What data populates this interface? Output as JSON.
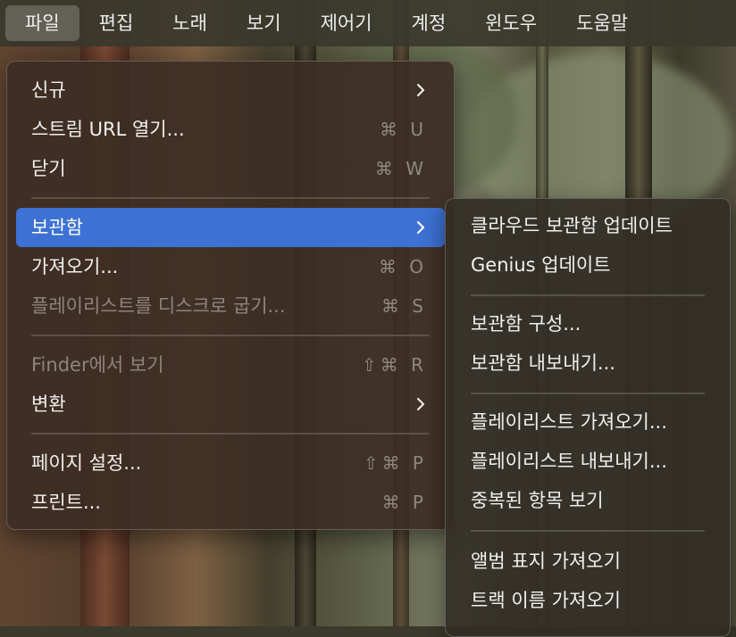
{
  "menubar": {
    "items": [
      "파일",
      "편집",
      "노래",
      "보기",
      "제어기",
      "계정",
      "윈도우",
      "도움말"
    ],
    "active_index": 0
  },
  "file_menu": {
    "new": {
      "label": "신규"
    },
    "open_stream": {
      "label": "스트림 URL 열기...",
      "shortcut": "⌘ U"
    },
    "close": {
      "label": "닫기",
      "shortcut": "⌘ W"
    },
    "library": {
      "label": "보관함"
    },
    "import": {
      "label": "가져오기...",
      "shortcut": "⌘ O"
    },
    "burn_playlist": {
      "label": "플레이리스트를 디스크로 굽기...",
      "shortcut": "⌘ S"
    },
    "show_in_finder": {
      "label": "Finder에서 보기",
      "shortcut": "⇧⌘ R"
    },
    "convert": {
      "label": "변환"
    },
    "page_setup": {
      "label": "페이지 설정...",
      "shortcut": "⇧⌘ P"
    },
    "print": {
      "label": "프린트...",
      "shortcut": "⌘ P"
    }
  },
  "library_submenu": {
    "items": [
      "클라우드 보관함 업데이트",
      "Genius 업데이트",
      "보관함 구성...",
      "보관함 내보내기...",
      "플레이리스트 가져오기...",
      "플레이리스트 내보내기...",
      "중복된 항목 보기",
      "앨범 표지 가져오기",
      "트랙 이름 가져오기"
    ]
  },
  "colors": {
    "highlight": "#3d71d3",
    "menu_text": "#f0f0f0",
    "disabled_text": "#8c857d"
  }
}
